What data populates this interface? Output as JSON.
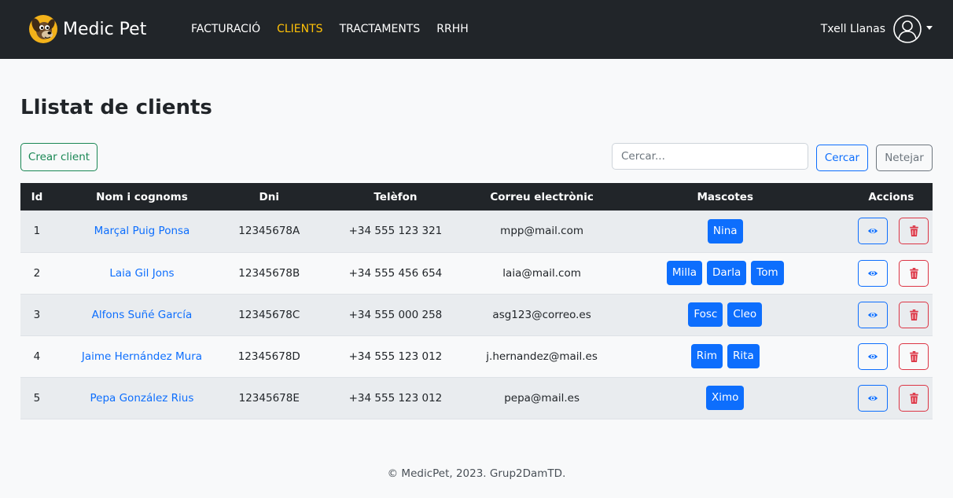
{
  "brand": {
    "name": "Medic Pet"
  },
  "nav": [
    {
      "label": "FACTURACIÓ",
      "active": false
    },
    {
      "label": "CLIENTS",
      "active": true
    },
    {
      "label": "TRACTAMENTS",
      "active": false
    },
    {
      "label": "RRHH",
      "active": false
    }
  ],
  "user": {
    "name": "Txell Llanas"
  },
  "page": {
    "title": "Llistat de clients"
  },
  "toolbar": {
    "create_label": "Crear client",
    "search_placeholder": "Cercar...",
    "search_value": "",
    "search_label": "Cercar",
    "clear_label": "Netejar"
  },
  "table": {
    "headers": [
      "Id",
      "Nom i cognoms",
      "Dni",
      "Telèfon",
      "Correu electrònic",
      "Mascotes",
      "Accions"
    ],
    "rows": [
      {
        "id": "1",
        "name": "Marçal Puig Ponsa",
        "dni": "12345678A",
        "phone": "+34 555 123 321",
        "email": "mpp@mail.com",
        "pets": [
          "Nina"
        ]
      },
      {
        "id": "2",
        "name": "Laia Gil Jons",
        "dni": "12345678B",
        "phone": "+34 555 456 654",
        "email": "laia@mail.com",
        "pets": [
          "Milla",
          "Darla",
          "Tom"
        ]
      },
      {
        "id": "3",
        "name": "Alfons Suñé García",
        "dni": "12345678C",
        "phone": "+34 555 000 258",
        "email": "asg123@correo.es",
        "pets": [
          "Fosc",
          "Cleo"
        ]
      },
      {
        "id": "4",
        "name": "Jaime Hernández Mura",
        "dni": "12345678D",
        "phone": "+34 555 123 012",
        "email": "j.hernandez@mail.es",
        "pets": [
          "Rim",
          "Rita"
        ]
      },
      {
        "id": "5",
        "name": "Pepa González Rius",
        "dni": "12345678E",
        "phone": "+34 555 123 012",
        "email": "pepa@mail.es",
        "pets": [
          "Ximo"
        ]
      }
    ]
  },
  "footer": {
    "text": "© MedicPet, 2023. Grup2DamTD."
  },
  "icons": {
    "logo": "dog-logo-icon",
    "user": "user-circle-icon",
    "view": "eye-icon",
    "delete": "trash-icon",
    "caret": "caret-down-icon"
  },
  "colors": {
    "navbar": "#212529",
    "active_nav": "#ffc107",
    "primary": "#0d6efd",
    "success": "#198754",
    "danger": "#dc3545",
    "secondary": "#6c757d"
  }
}
